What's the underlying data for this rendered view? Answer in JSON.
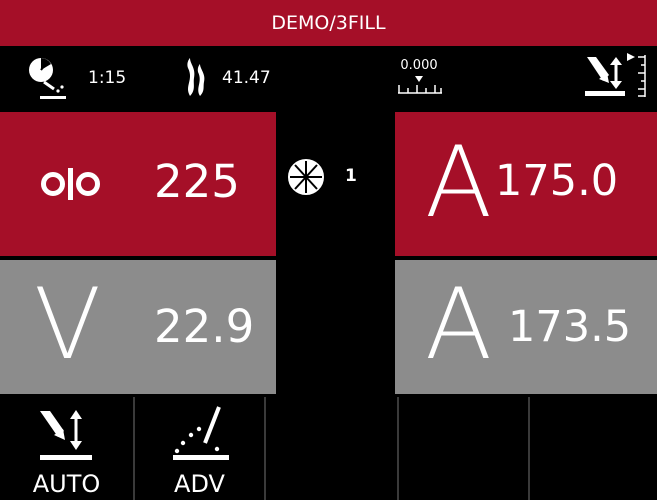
{
  "title": "DEMO/3FILL",
  "status": {
    "arc_time_icon": "arc-timer-icon",
    "arc_time": "1:15",
    "heat_icon": "heat-input-icon",
    "heat_value": "41.47",
    "travel_value": "0.000",
    "travel_icon": "travel-scale-icon",
    "wire_feed_icon": "wire-feed-adjust-icon"
  },
  "panels": {
    "wfs_value": "225",
    "wfs_icon": "wire-feed-speed-icon",
    "procedure_icon": "procedure-wheel-icon",
    "procedure_number": "1",
    "amp_preset_letter": "A",
    "amp_preset_value": "175.0",
    "volt_letter": "V",
    "volt_value": "22.9",
    "amp_actual_letter": "A",
    "amp_actual_value": "173.5"
  },
  "softkeys": [
    {
      "label": "AUTO",
      "icon": "auto-wire-icon"
    },
    {
      "label": "ADV",
      "icon": "advanced-arc-icon"
    },
    {
      "label": ""
    },
    {
      "label": ""
    },
    {
      "label": ""
    }
  ],
  "colors": {
    "accent": "#a50f28",
    "panel_gray": "#8c8c8c",
    "background": "#000000"
  }
}
